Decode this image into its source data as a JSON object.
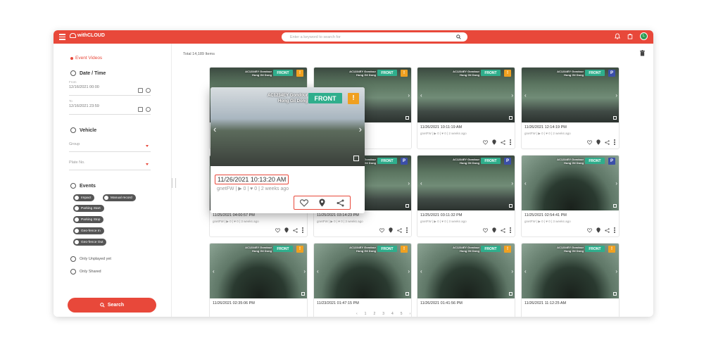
{
  "app": {
    "brand": "withCLOUD",
    "avatar_initial": "L"
  },
  "search": {
    "placeholder": "Enter a keyword to search for"
  },
  "sidebar": {
    "section_title": "Event Videos",
    "date_time": {
      "label": "Date / Time",
      "from_label": "From",
      "from_value": "12/16/2021 00:00",
      "to_label": "To",
      "to_value": "12/16/2021 23:59"
    },
    "vehicle": {
      "label": "Vehicle",
      "group_placeholder": "Group",
      "plate_placeholder": "Plate No."
    },
    "events": {
      "label": "Events",
      "chips": [
        "Impact",
        "Manual record",
        "Parking Start",
        "Parking Stop",
        "Geo-fence In",
        "Geo-fence Out"
      ]
    },
    "only_unplayed": "Only Unplayed yet",
    "only_shared": "Only Shared",
    "search_button": "Search"
  },
  "main": {
    "total": "Total 14,189 Items",
    "cards": [
      {
        "time": "",
        "meta": "",
        "front": "FRONT",
        "badge": "!",
        "scene": "garage"
      },
      {
        "time": "",
        "meta": "",
        "front": "FRONT",
        "badge": "!",
        "scene": "garage"
      },
      {
        "time": "11/26/2021 10:11:19 AM",
        "meta": "gnetFW | ▶ 0 | ♥ 0 | 2 weeks ago",
        "front": "FRONT",
        "badge": "!",
        "scene": "garage"
      },
      {
        "time": "11/26/2021 12:14:19 PM",
        "meta": "gnetFW | ▶ 0 | ♥ 0 | 2 weeks ago",
        "front": "FRONT",
        "badge": "P",
        "scene": "garage"
      },
      {
        "time": "11/25/2021 04:00:57 PM",
        "meta": "gnetFW | ▶ 0 | ♥ 0 | 3 weeks ago",
        "front": "FRONT",
        "badge": "!",
        "scene": "garage"
      },
      {
        "time": "11/25/2021 03:14:23 PM",
        "meta": "gnetFW | ▶ 0 | ♥ 0 | 3 weeks ago",
        "front": "FRONT",
        "badge": "P",
        "scene": "garage"
      },
      {
        "time": "11/25/2021 03:11:32 PM",
        "meta": "gnetFW | ▶ 0 | ♥ 0 | 3 weeks ago",
        "front": "FRONT",
        "badge": "P",
        "scene": "garage"
      },
      {
        "time": "11/25/2021 02:54:41 PM",
        "meta": "gnetFW | ▶ 0 | ♥ 0 | 3 weeks ago",
        "front": "FRONT",
        "badge": "P",
        "scene": "dome"
      },
      {
        "time": "11/26/2021 02:35:06 PM",
        "meta": "",
        "front": "FRONT",
        "badge": "!",
        "scene": "dome"
      },
      {
        "time": "11/23/2021 01:47:15 PM",
        "meta": "",
        "front": "FRONT",
        "badge": "!",
        "scene": "dome"
      },
      {
        "time": "11/26/2021 01:41:56 PM",
        "meta": "",
        "front": "FRONT",
        "badge": "!",
        "scene": "dome"
      },
      {
        "time": "11/26/2021 11:12:25 AM",
        "meta": "",
        "front": "FRONT",
        "badge": "!",
        "scene": "dome"
      }
    ],
    "card_label": "AC1234EY Gondour Hong Gil Dong",
    "popup": {
      "label": "AC1234EY Gondour Hong Gil Dong",
      "front": "FRONT",
      "badge": "!",
      "time": "11/26/2021 10:13:20 AM",
      "meta": "gnetFW | ▶ 0 | ♥ 0 | 2 weeks ago"
    },
    "pagination": [
      "‹",
      "1",
      "2",
      "3",
      "4",
      "5",
      "›"
    ]
  },
  "colors": {
    "accent": "#e8483a",
    "front_tag": "#2fae8c",
    "event_badge": "#f0a020",
    "parking_badge": "#3b4fa8"
  }
}
